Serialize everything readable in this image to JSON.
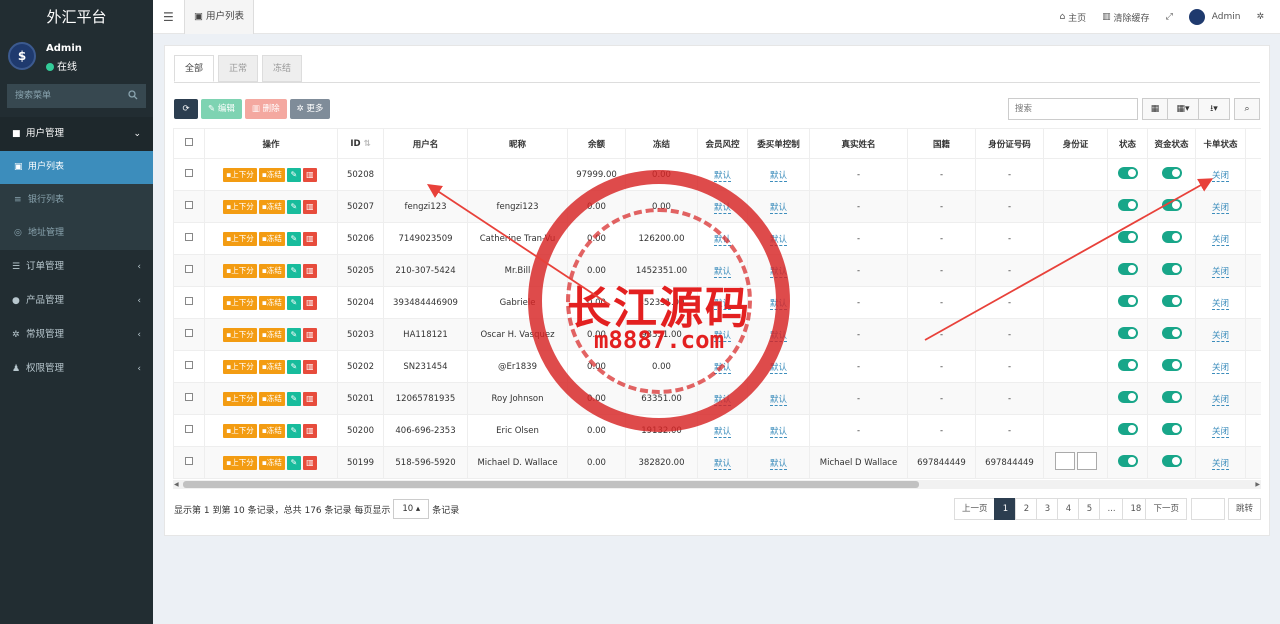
{
  "sidebar": {
    "brand": "外汇平台",
    "user": {
      "name": "Admin",
      "status": "在线"
    },
    "search_placeholder": "搜索菜单",
    "menu": [
      {
        "label": "用户管理",
        "icon": "user-icon",
        "open": true
      },
      {
        "label": "订单管理",
        "icon": "list-icon"
      },
      {
        "label": "产品管理",
        "icon": "product-icon"
      },
      {
        "label": "常规管理",
        "icon": "cogs-icon"
      },
      {
        "label": "权限管理",
        "icon": "group-icon"
      }
    ],
    "submenu": [
      {
        "label": "用户列表",
        "icon": "user-list-icon",
        "active": true
      },
      {
        "label": "银行列表",
        "icon": "database-icon"
      },
      {
        "label": "地址管理",
        "icon": "address-icon"
      }
    ]
  },
  "topbar": {
    "tab_label": "用户列表",
    "home": "主页",
    "clear_cache": "清除缓存",
    "admin": "Admin"
  },
  "filters": {
    "all": "全部",
    "normal": "正常",
    "frozen": "冻结"
  },
  "toolbar": {
    "edit": "编辑",
    "delete": "删除",
    "more": "更多"
  },
  "search_placeholder": "搜索",
  "table": {
    "headers": [
      "操作",
      "ID",
      "用户名",
      "昵称",
      "余额",
      "冻结",
      "会员风控",
      "委买单控制",
      "真实姓名",
      "国籍",
      "身份证号码",
      "身份证",
      "状态",
      "资金状态",
      "卡单状态"
    ],
    "row_actions": {
      "topup": "上下分",
      "freeze": "冻结"
    },
    "rows": [
      {
        "id": "50208",
        "username": "",
        "nickname": "",
        "balance": "97999.00",
        "frozen": "0.00",
        "risk": "默认",
        "order_ctrl": "默认",
        "realname": "-",
        "nationality": "-",
        "idno": "-",
        "card": "关闭",
        "id_images": false
      },
      {
        "id": "50207",
        "username": "fengzi123",
        "nickname": "fengzi123",
        "balance": "0.00",
        "frozen": "0.00",
        "risk": "默认",
        "order_ctrl": "默认",
        "realname": "-",
        "nationality": "-",
        "idno": "-",
        "card": "关闭",
        "id_images": false
      },
      {
        "id": "50206",
        "username": "7149023509",
        "nickname": "Catherine Tran-Vu",
        "balance": "0.00",
        "frozen": "126200.00",
        "risk": "默认",
        "order_ctrl": "默认",
        "realname": "-",
        "nationality": "-",
        "idno": "-",
        "card": "关闭",
        "id_images": false
      },
      {
        "id": "50205",
        "username": "210-307-5424",
        "nickname": "Mr.Bill",
        "balance": "0.00",
        "frozen": "1452351.00",
        "risk": "默认",
        "order_ctrl": "默认",
        "realname": "-",
        "nationality": "-",
        "idno": "-",
        "card": "关闭",
        "id_images": false
      },
      {
        "id": "50204",
        "username": "393484446909",
        "nickname": "Gabriele",
        "balance": "0.00",
        "frozen": "452351.00",
        "risk": "默认",
        "order_ctrl": "默认",
        "realname": "-",
        "nationality": "-",
        "idno": "-",
        "card": "关闭",
        "id_images": false
      },
      {
        "id": "50203",
        "username": "HA118121",
        "nickname": "Oscar H. Vasquez",
        "balance": "0.00",
        "frozen": "93351.00",
        "risk": "默认",
        "order_ctrl": "默认",
        "realname": "-",
        "nationality": "-",
        "idno": "-",
        "card": "关闭",
        "id_images": false
      },
      {
        "id": "50202",
        "username": "SN231454",
        "nickname": "@Er1839",
        "balance": "0.00",
        "frozen": "0.00",
        "risk": "默认",
        "order_ctrl": "默认",
        "realname": "-",
        "nationality": "-",
        "idno": "-",
        "card": "关闭",
        "id_images": false
      },
      {
        "id": "50201",
        "username": "12065781935",
        "nickname": "Roy Johnson",
        "balance": "0.00",
        "frozen": "63351.00",
        "risk": "默认",
        "order_ctrl": "默认",
        "realname": "-",
        "nationality": "-",
        "idno": "-",
        "card": "关闭",
        "id_images": false
      },
      {
        "id": "50200",
        "username": "406-696-2353",
        "nickname": "Eric Olsen",
        "balance": "0.00",
        "frozen": "19132.00",
        "risk": "默认",
        "order_ctrl": "默认",
        "realname": "-",
        "nationality": "-",
        "idno": "-",
        "card": "关闭",
        "id_images": false
      },
      {
        "id": "50199",
        "username": "518-596-5920",
        "nickname": "Michael D. Wallace",
        "balance": "0.00",
        "frozen": "382820.00",
        "risk": "默认",
        "order_ctrl": "默认",
        "realname": "Michael D Wallace",
        "nationality": "697844449",
        "idno": "697844449",
        "card": "关闭",
        "id_images": true
      }
    ]
  },
  "pagination": {
    "info_before": "显示第 1 到第 10 条记录，总共 176 条记录 每页显示",
    "page_size": "10",
    "info_after": "条记录",
    "prev": "上一页",
    "pages": [
      "1",
      "2",
      "3",
      "4",
      "5",
      "...",
      "18"
    ],
    "next": "下一页",
    "jump": "跳转"
  },
  "watermark": {
    "line1": "长江源码",
    "line2": "m8887.com"
  },
  "colors": {
    "sidebar": "#222d32",
    "active": "#3c8dbc",
    "orange": "#f39c12",
    "green": "#18bc9c",
    "red": "#e74c3c",
    "toggle": "#18a689",
    "watermark": "#e32020"
  }
}
